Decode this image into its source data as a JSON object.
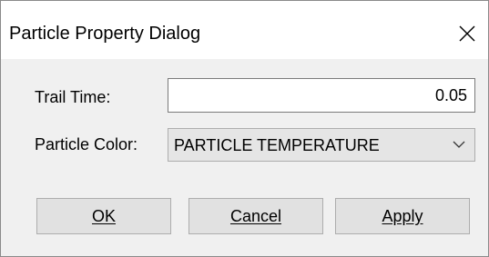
{
  "window": {
    "title": "Particle Property Dialog"
  },
  "form": {
    "trail_time": {
      "label": "Trail Time:",
      "value": "0.05"
    },
    "particle_color": {
      "label": "Particle Color:",
      "selected": "PARTICLE TEMPERATURE"
    }
  },
  "buttons": {
    "ok": "OK",
    "cancel": "Cancel",
    "apply": "Apply"
  },
  "icons": {
    "close": "close-icon",
    "dropdown": "chevron-down-icon"
  }
}
